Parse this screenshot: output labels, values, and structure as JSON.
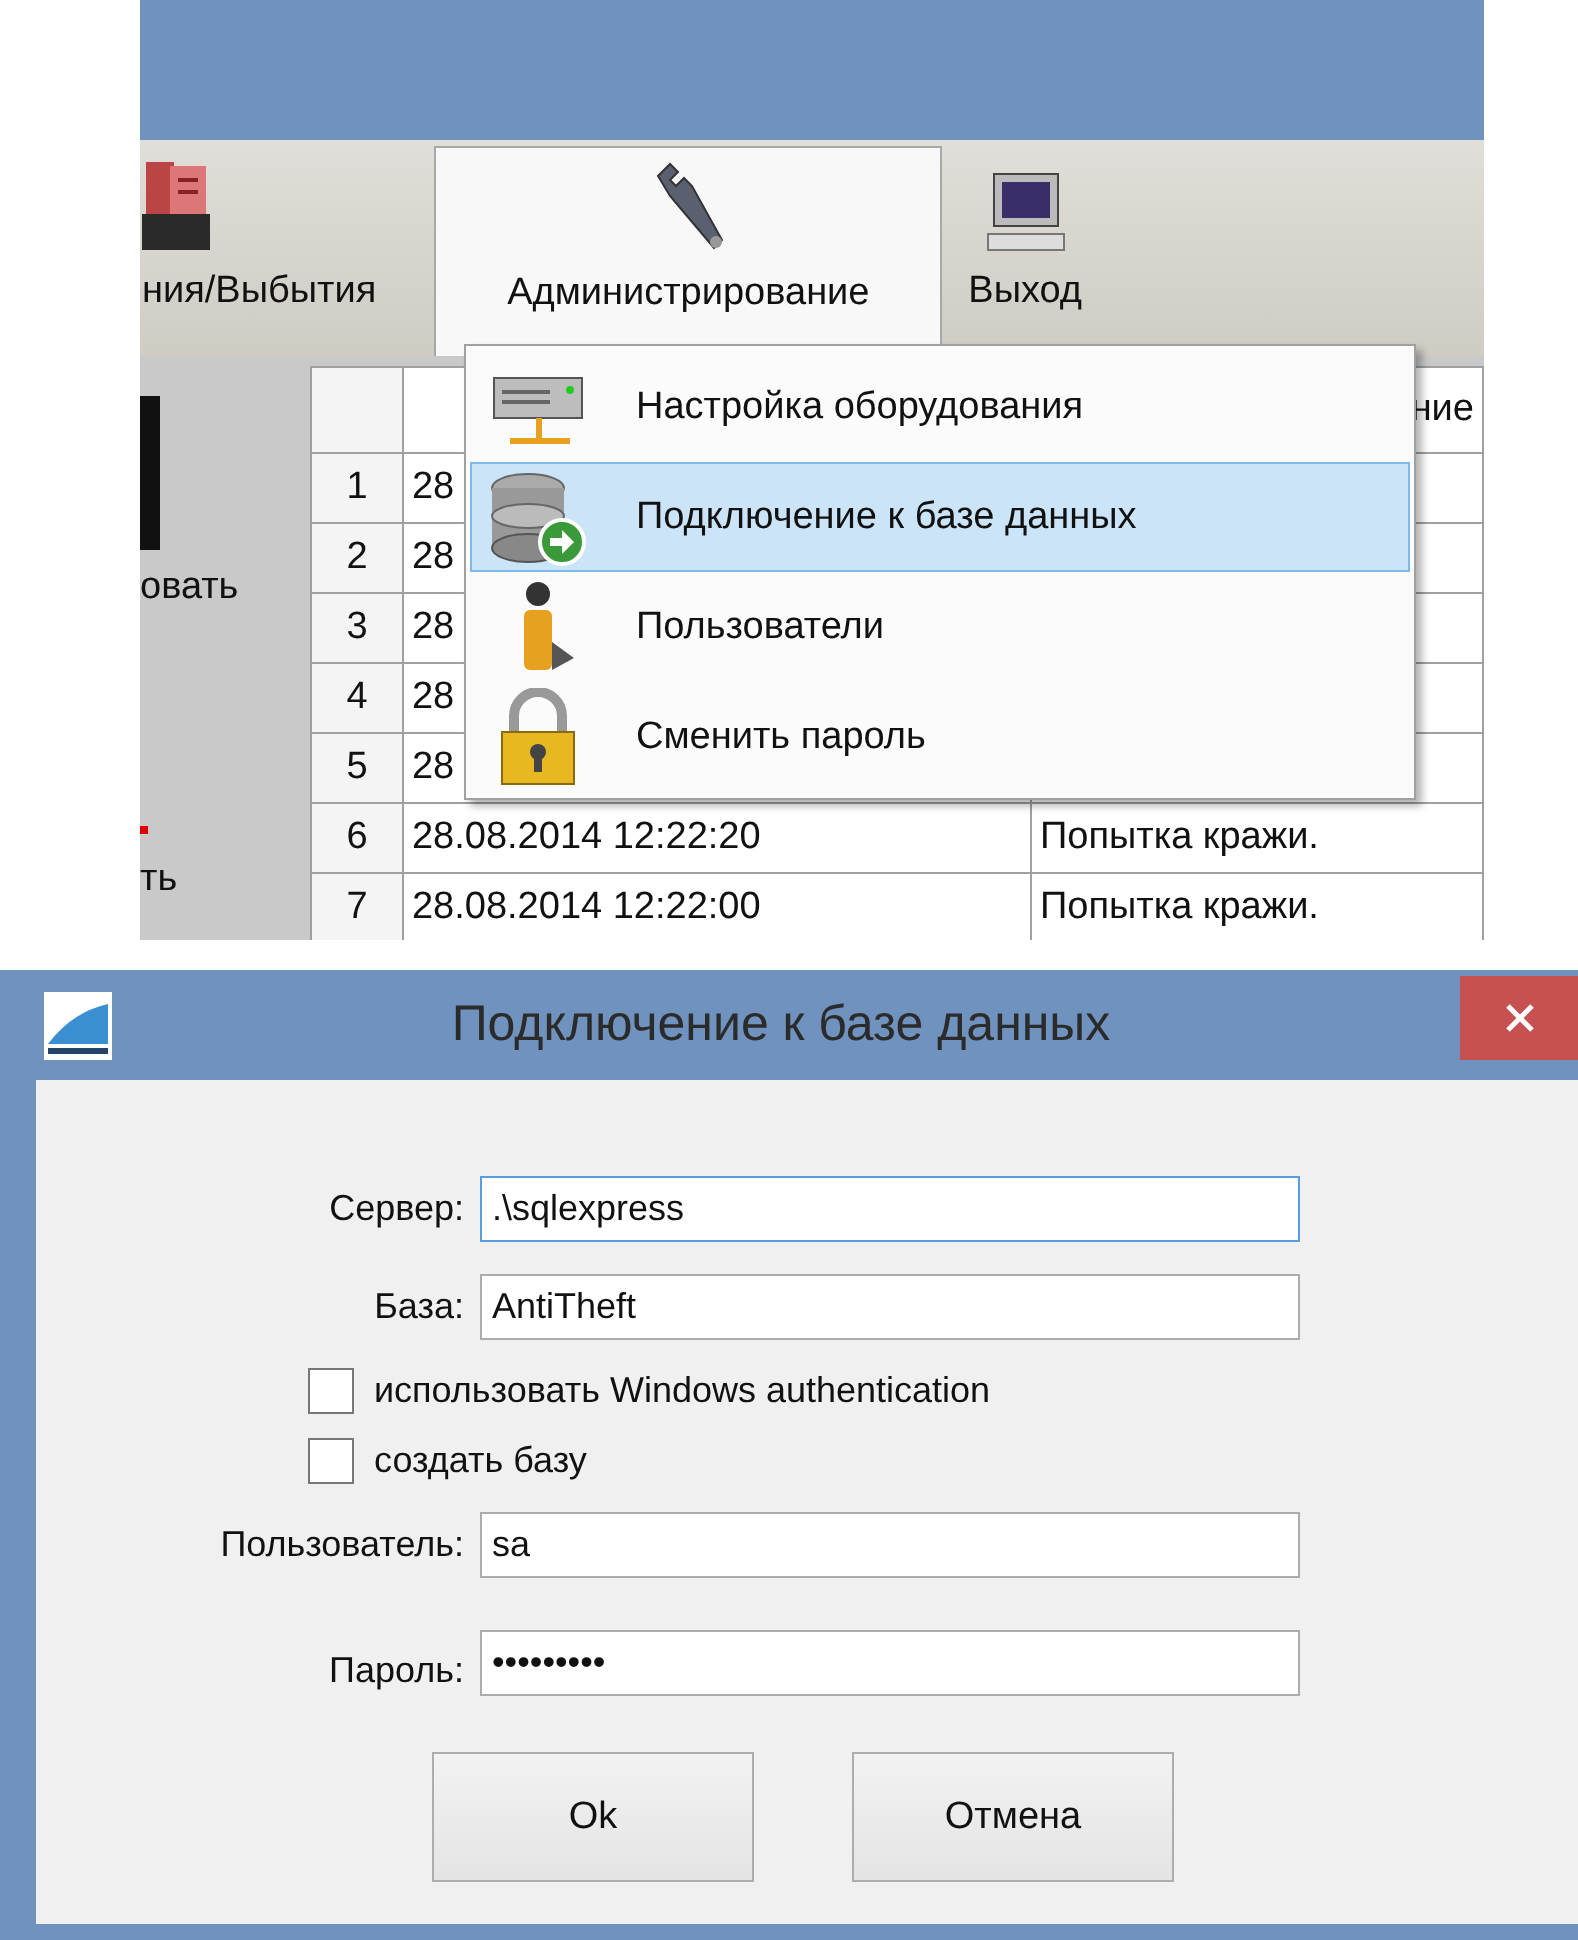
{
  "app_window": {
    "toolbar": [
      {
        "label": "ния/Выбытия",
        "selected": false
      },
      {
        "label": "Администрирование",
        "selected": true
      },
      {
        "label": "Выход",
        "selected": false
      }
    ],
    "side_panel": {
      "texts": [
        "овать",
        "ть"
      ]
    },
    "table": {
      "header_column_3": "ние",
      "rows": [
        {
          "number": "1",
          "column_2": "28"
        },
        {
          "number": "2",
          "column_2": "28"
        },
        {
          "number": "3",
          "column_2": "28"
        },
        {
          "number": "4",
          "column_2": "28"
        },
        {
          "number": "5",
          "column_2": "28"
        },
        {
          "number": "6",
          "column_2": "28.08.2014 12:22:20",
          "column_3": "Попытка кражи."
        },
        {
          "number": "7",
          "column_2": "28.08.2014 12:22:00",
          "column_3": "Попытка кражи."
        }
      ]
    },
    "menu": {
      "items": [
        {
          "label": "Настройка оборудования",
          "selected": false
        },
        {
          "label": "Подключение к базе данных",
          "selected": true
        },
        {
          "label": "Пользователи",
          "selected": false
        },
        {
          "label": "Сменить пароль",
          "selected": false
        }
      ]
    }
  },
  "dialog": {
    "title": "Подключение к базе данных",
    "form": [
      {
        "kind": "field",
        "label": "Сервер:",
        "value": ".\\sqlexpress",
        "focused": true
      },
      {
        "kind": "field",
        "label": "База:",
        "value": "AntiTheft",
        "focused": false
      },
      {
        "kind": "checkbox",
        "label": "использовать Windows authentication",
        "checked": false
      },
      {
        "kind": "checkbox",
        "label": "создать базу",
        "checked": false
      },
      {
        "kind": "field",
        "label": "Пользователь:",
        "value": "sa",
        "focused": false
      },
      {
        "kind": "field",
        "label": "Пароль:",
        "value": "•••••••••",
        "focused": false
      }
    ],
    "buttons": [
      "Ok",
      "Отмена"
    ]
  }
}
